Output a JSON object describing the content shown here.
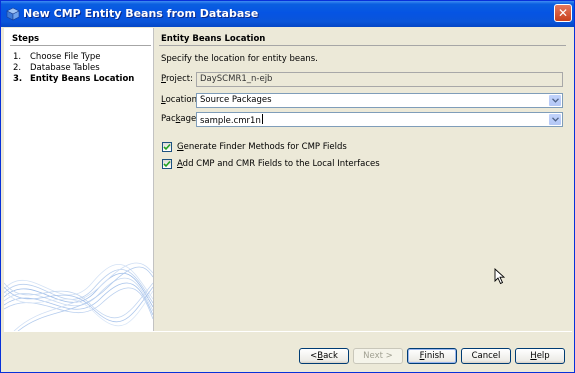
{
  "window": {
    "title": "New CMP Entity Beans from Database",
    "close_glyph": "✕"
  },
  "steps": {
    "title": "Steps",
    "items": [
      {
        "num": "1.",
        "label": "Choose File Type"
      },
      {
        "num": "2.",
        "label": "Database Tables"
      },
      {
        "num": "3.",
        "label": "Entity Beans Location"
      }
    ]
  },
  "main": {
    "title": "Entity Beans Location",
    "description": "Specify the location for entity beans.",
    "project": {
      "label_first": "P",
      "label_rest": "roject:",
      "value": "DaySCMR1_n-ejb"
    },
    "location": {
      "label_first": "L",
      "label_rest": "ocation:",
      "value": "Source Packages"
    },
    "package": {
      "label_pre": "Pac",
      "label_u": "k",
      "label_rest": "age:",
      "value": "sample.cmr1n"
    },
    "checkbox_finder": {
      "label_first": "G",
      "label_rest": "enerate Finder Methods for CMP Fields",
      "checked": true
    },
    "checkbox_cmp": {
      "label_pre": "",
      "label_u": "A",
      "label_rest": "dd CMP and CMR Fields to the Local Interfaces",
      "checked": true
    }
  },
  "buttons": {
    "back": {
      "pre": "< ",
      "u": "B",
      "rest": "ack"
    },
    "next": {
      "label": "Next >"
    },
    "finish": {
      "u": "F",
      "rest": "inish"
    },
    "cancel": {
      "label": "Cancel"
    },
    "help": {
      "u": "H",
      "rest": "elp"
    }
  },
  "colors": {
    "titlebar": "#0554e3",
    "panel": "#ece9d8",
    "accent": "#316ac5"
  }
}
